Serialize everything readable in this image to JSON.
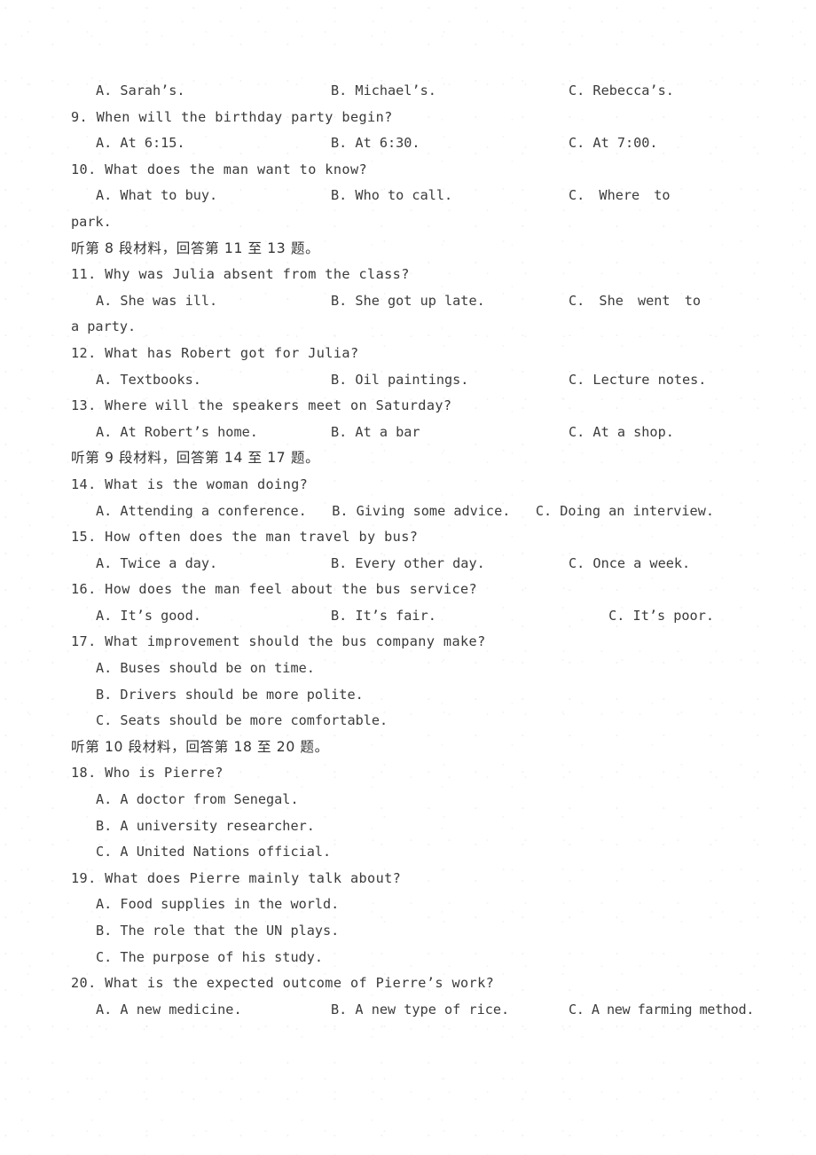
{
  "document": {
    "type": "listening-comprehension-exam-page",
    "language_mix": "english-chinese",
    "text_color": "#3c3c3c",
    "background_color": "#ffffff"
  },
  "lines": {
    "q8_options": {
      "a": "A. Sarah’s.",
      "b": "B. Michael’s.",
      "c": "C. Rebecca’s."
    },
    "q9": {
      "stem": "9. When will the birthday party begin?",
      "a": "A. At 6:15.",
      "b": "B. At 6:30.",
      "c": "C. At 7:00."
    },
    "q10": {
      "stem": "10. What does the man want to know?",
      "a": "A. What to buy.",
      "b": "B. Who  to  call.",
      "c": "C.   Where  to",
      "c_cont": "park."
    },
    "heading_8": "听第 8 段材料，回答第 11 至 13 题。",
    "q11": {
      "stem": "11. Why was Julia absent from the class?",
      "a": "A. She was ill.",
      "b": "B. She got  up  late.",
      "c": "C.  She  went  to",
      "c_cont": "a  party."
    },
    "q12": {
      "stem": "12. What has Robert got for Julia?",
      "a": "A. Textbooks.",
      "b": "B. Oil paintings.",
      "c": "C. Lecture notes."
    },
    "q13": {
      "stem": "13. Where will the speakers meet on Saturday?",
      "a": "A. At Robert’s  home.",
      "b": "B. At  a bar",
      "c": "C. At  a shop."
    },
    "heading_9": "听第 9 段材料，回答第 14 至 17 题。",
    "q14": {
      "stem": "14. What is the woman doing?",
      "a": "A. Attending a conference.",
      "b": "B. Giving some advice.",
      "c": "C. Doing an interview."
    },
    "q15": {
      "stem": "15. How often does the man travel by bus?",
      "a": "A. Twice a day.",
      "b": "B. Every other day.",
      "c": "C. Once a week."
    },
    "q16": {
      "stem": "16. How does the man feel about the bus service?",
      "a": "A. It’s good.",
      "b": "B. It’s fair.",
      "c": "C. It’s poor."
    },
    "q17": {
      "stem": "17. What improvement should the bus company make?",
      "a": "A. Buses should be on time.",
      "b": "B. Drivers should be more polite.",
      "c": "C. Seats should be more comfortable."
    },
    "heading_10": "听第 10 段材料，回答第 18 至 20 题。",
    "q18": {
      "stem": "18. Who is Pierre?",
      "a": "A. A doctor from Senegal.",
      "b": "B. A university researcher.",
      "c": "C. A United Nations official."
    },
    "q19": {
      "stem": "19. What does Pierre mainly talk about?",
      "a": "A. Food supplies in the world.",
      "b": "B. The role that the UN plays.",
      "c": "C. The purpose of his study."
    },
    "q20": {
      "stem": "20. What is the expected outcome of Pierre’s work?",
      "a": "A. A new medicine.",
      "b": "B. A new type of  rice.",
      "c": "C. A new farming method."
    }
  }
}
